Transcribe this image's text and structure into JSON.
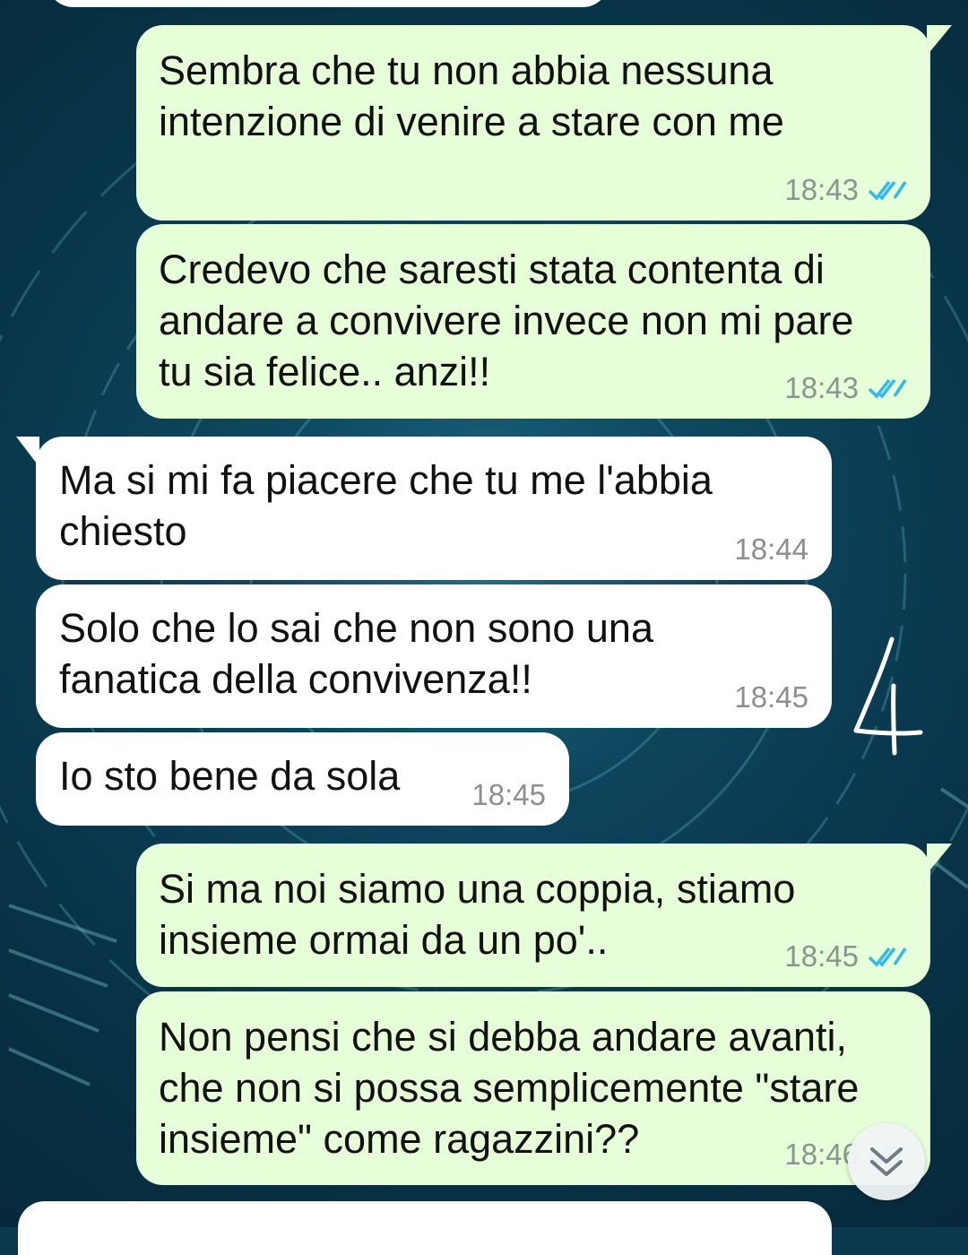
{
  "chat": {
    "messages": [
      {
        "direction": "outgoing",
        "text": "Sembra che tu non abbia nessuna\nintenzione di venire a stare con me",
        "time": "18:43",
        "status": "read"
      },
      {
        "direction": "outgoing",
        "text": "Credevo che saresti stata contenta di\nandare a convivere invece non mi pare\ntu sia felice.. anzi!!",
        "time": "18:43",
        "status": "read"
      },
      {
        "direction": "incoming",
        "text": "Ma si mi fa piacere che tu me l'abbia\nchiesto",
        "time": "18:44"
      },
      {
        "direction": "incoming",
        "text": "Solo che lo sai che non sono una\nfanatica della convivenza!!",
        "time": "18:45"
      },
      {
        "direction": "incoming",
        "text": "Io sto bene da sola",
        "time": "18:45"
      },
      {
        "direction": "outgoing",
        "text": "Si ma noi siamo una coppia, stiamo\ninsieme ormai da un po'..",
        "time": "18:45",
        "status": "read"
      },
      {
        "direction": "outgoing",
        "text": "Non pensi che si debba andare avanti,\nche non si possa semplicemente \"stare\ninsieme\" come ragazzini??",
        "time": "18:46",
        "status": "read"
      }
    ]
  },
  "annotation": {
    "text": "4"
  },
  "icons": {
    "read_ticks": "double-check-icon",
    "scroll_down": "chevron-double-down-icon"
  },
  "colors": {
    "outgoing_bubble": "#e6ffd9",
    "incoming_bubble": "#ffffff",
    "read_tick": "#34b7f1",
    "timestamp": "#8b948f"
  }
}
